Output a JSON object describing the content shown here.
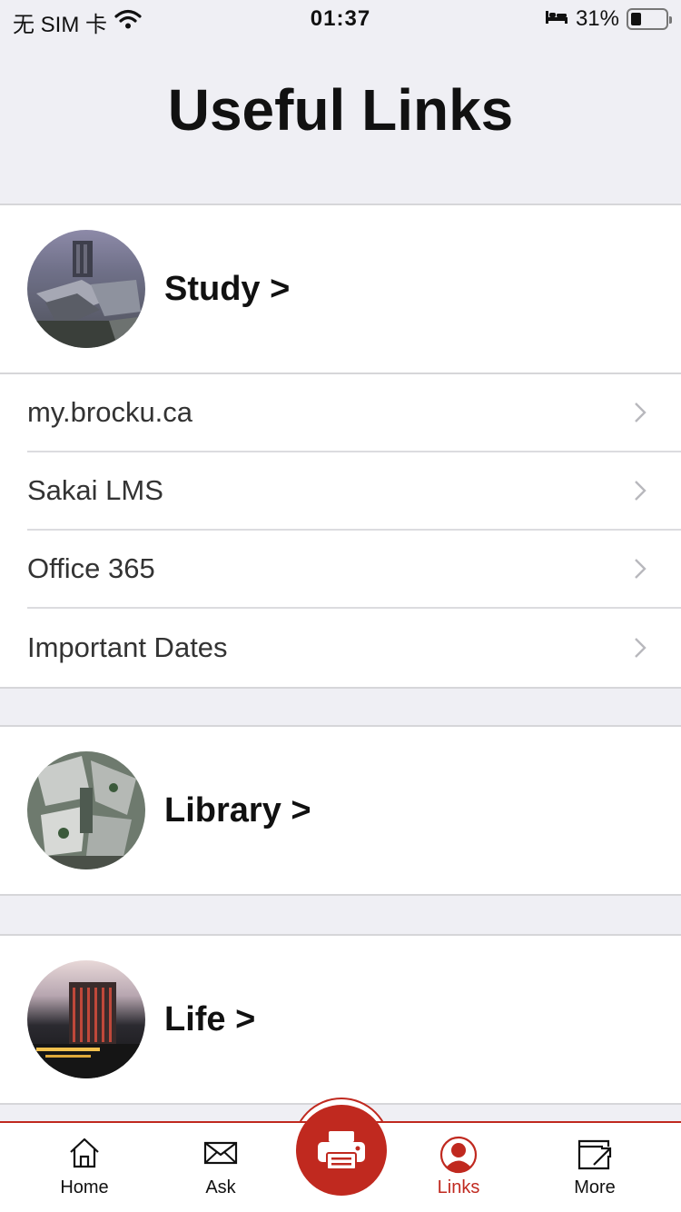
{
  "status_bar": {
    "carrier": "无 SIM 卡",
    "time": "01:37",
    "battery_percent": "31%",
    "battery_level": 0.31
  },
  "page": {
    "title": "Useful Links"
  },
  "sections": {
    "study": {
      "title": "Study >",
      "links": [
        "my.brocku.ca",
        "Sakai LMS",
        "Office 365",
        "Important Dates"
      ]
    },
    "library": {
      "title": "Library >"
    },
    "life": {
      "title": "Life >"
    }
  },
  "tab_bar": {
    "home": "Home",
    "ask": "Ask",
    "links": "Links",
    "more": "More",
    "center_icon": "printer-icon",
    "active": "Links"
  },
  "colors": {
    "accent": "#c0291f",
    "background": "#efeff4"
  }
}
